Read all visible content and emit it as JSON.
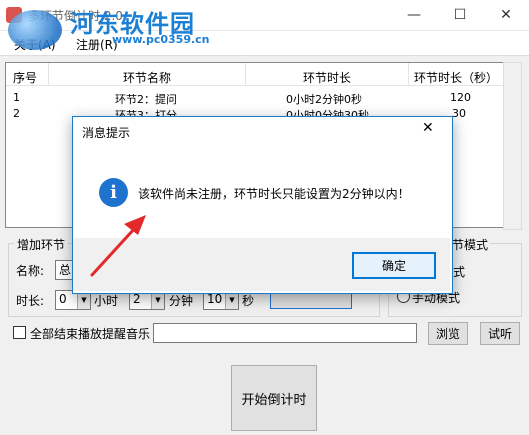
{
  "window": {
    "title": "多环节倒计时 2.0",
    "minimize_glyph": "—",
    "maximize_glyph": "☐",
    "close_glyph": "✕"
  },
  "watermark": {
    "text": "河东软件园",
    "url": "www.pc0359.cn"
  },
  "menu": {
    "items": [
      "关于(A)",
      "注册(R)"
    ]
  },
  "list": {
    "columns": [
      "序号",
      "环节名称",
      "环节时长",
      "环节时长（秒）"
    ],
    "rows": [
      [
        "1",
        "环节2：提问",
        "0小时2分钟0秒",
        "120"
      ],
      [
        "2",
        "环节3：打分",
        "0小时0分钟30秒",
        "30"
      ]
    ]
  },
  "add_section": {
    "title": "增加环节",
    "name_label": "名称:",
    "name_value": "总",
    "duration_label": "时长:",
    "hours_value": "0",
    "hours_unit": "小时",
    "minutes_value": "2",
    "minutes_unit": "分钟",
    "seconds_value": "10",
    "seconds_unit": "秒"
  },
  "mode_section": {
    "title": "环节模式",
    "option_auto": "模式",
    "option_manual": "手动模式"
  },
  "music": {
    "checkbox_label": "全部结束播放提醒音乐",
    "path_value": "",
    "browse_label": "浏览",
    "test_label": "试听"
  },
  "start_button": {
    "label": "开始倒计时"
  },
  "dialog": {
    "title": "消息提示",
    "close_glyph": "✕",
    "icon_glyph": "i",
    "message": "该软件尚未注册，环节时长只能设置为2分钟以内！",
    "ok_label": "确定"
  }
}
